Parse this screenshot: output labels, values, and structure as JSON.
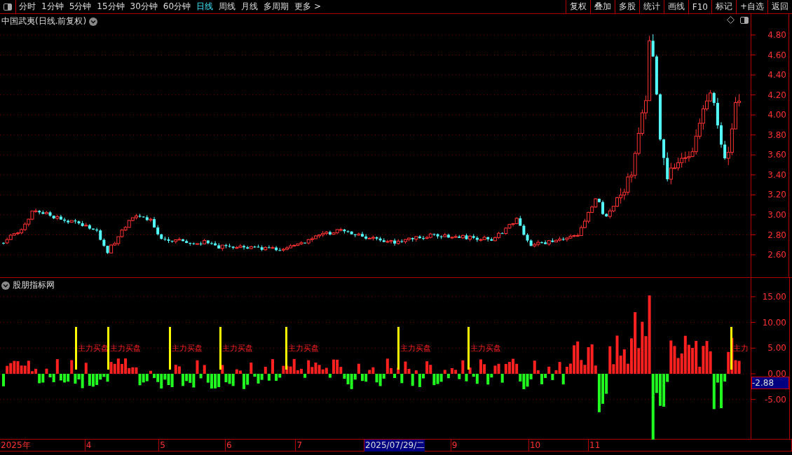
{
  "toolbar": {
    "periods": [
      {
        "label": "分时",
        "selected": false
      },
      {
        "label": "1分钟",
        "selected": false
      },
      {
        "label": "5分钟",
        "selected": false
      },
      {
        "label": "15分钟",
        "selected": false
      },
      {
        "label": "30分钟",
        "selected": false
      },
      {
        "label": "60分钟",
        "selected": false
      },
      {
        "label": "日线",
        "selected": true
      },
      {
        "label": "周线",
        "selected": false
      },
      {
        "label": "月线",
        "selected": false
      },
      {
        "label": "多周期",
        "selected": false
      },
      {
        "label": "更多 >",
        "selected": false
      }
    ],
    "actions": [
      "复权",
      "叠加",
      "多股",
      "统计",
      "画线",
      "F10",
      "标记",
      "+自选",
      "返回"
    ]
  },
  "main_chart": {
    "title": "中国武夷(日线.前复权)",
    "price_ticks": [
      "4.80",
      "4.60",
      "4.40",
      "4.20",
      "4.00",
      "3.80",
      "3.60",
      "3.40",
      "3.20",
      "3.00",
      "2.80",
      "2.60"
    ]
  },
  "indicator": {
    "title": "股朋指标网",
    "ticks": [
      "15.00",
      "10.00",
      "5.00",
      "0.00",
      "-5.00"
    ],
    "current_value": "-2.88",
    "signals": [
      {
        "label": "主力买盘"
      },
      {
        "label": "主力买盘"
      },
      {
        "label": "主力买盘"
      },
      {
        "label": "主力买盘"
      },
      {
        "label": "主力买盘"
      },
      {
        "label": "主力买盘"
      },
      {
        "label": "主力买盘"
      },
      {
        "label": "主力"
      }
    ]
  },
  "time_axis": [
    {
      "label": "2025年",
      "selected": false
    },
    {
      "label": "4",
      "selected": false
    },
    {
      "label": "5",
      "selected": false
    },
    {
      "label": "6",
      "selected": false
    },
    {
      "label": "7",
      "selected": false
    },
    {
      "label": "2025/07/29/二",
      "selected": true
    },
    {
      "label": "9",
      "selected": false
    },
    {
      "label": "10",
      "selected": false
    },
    {
      "label": "11",
      "selected": false
    }
  ]
}
